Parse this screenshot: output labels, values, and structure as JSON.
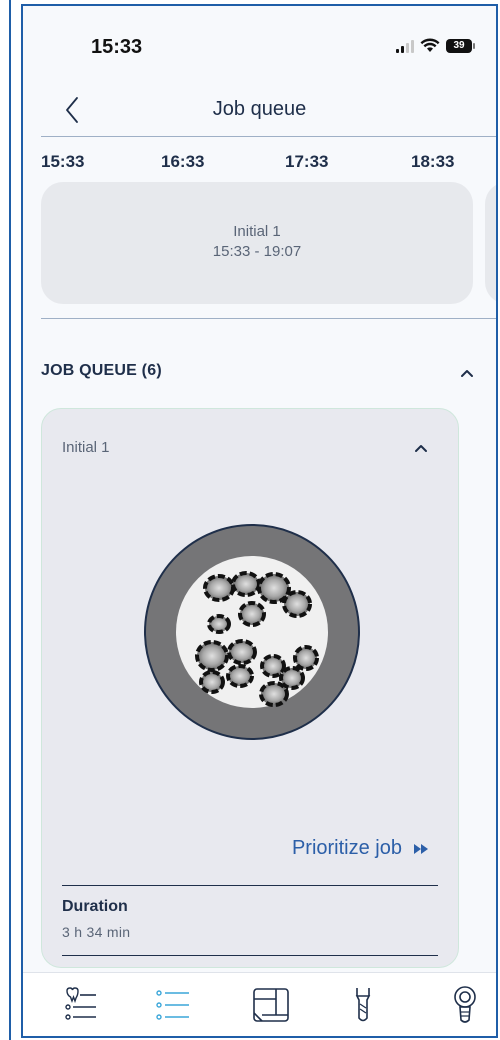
{
  "status_bar": {
    "time": "15:33",
    "battery": "39"
  },
  "nav": {
    "title": "Job queue"
  },
  "timeline": {
    "ticks": [
      "15:33",
      "16:33",
      "17:33",
      "18:33"
    ],
    "job": {
      "name": "Initial 1",
      "time_range": "15:33 - 19:07"
    }
  },
  "queue": {
    "title": "JOB QUEUE (6)",
    "card": {
      "name": "Initial 1",
      "prioritize_label": "Prioritize job",
      "duration_label": "Duration",
      "duration_value": "3 h 34 min"
    }
  },
  "tabs": [
    {
      "icon": "tooth-list-icon",
      "active": false
    },
    {
      "icon": "queue-list-icon",
      "active": true
    },
    {
      "icon": "layout-icon",
      "active": false
    },
    {
      "icon": "drill-icon",
      "active": false
    },
    {
      "icon": "implant-icon",
      "active": false
    }
  ],
  "colors": {
    "accent": "#2c5fa8",
    "active_tab": "#3aa6d9",
    "card_bg": "#e8e9ef",
    "text": "#1f2f4a"
  }
}
